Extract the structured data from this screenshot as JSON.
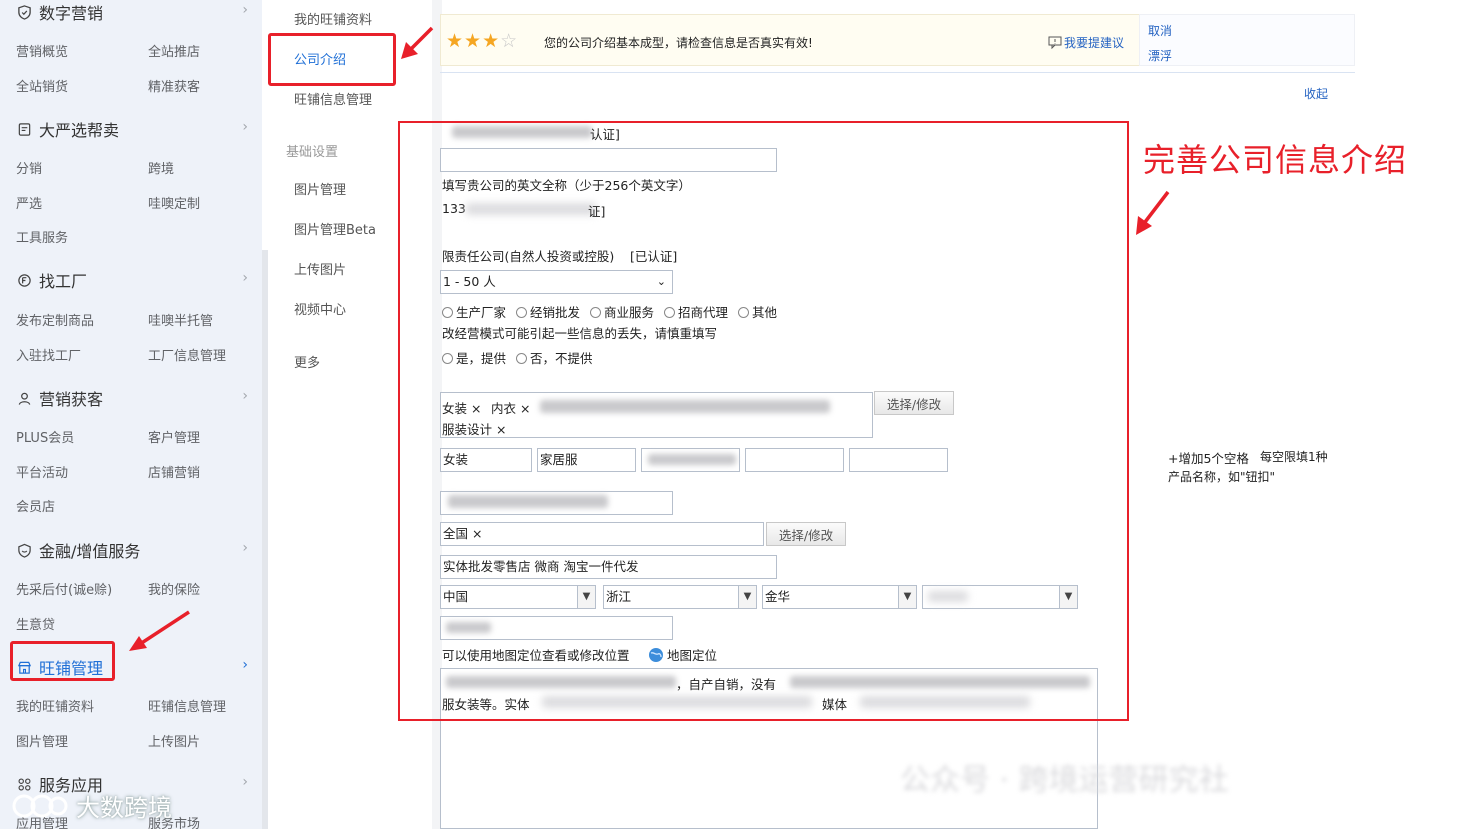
{
  "sidebar": {
    "sections": [
      {
        "title": "数字营销",
        "icon": "shield-icon",
        "links": [
          "营销概览",
          "全站推店",
          "全站销货",
          "精准获客"
        ]
      },
      {
        "title": "大严选帮卖",
        "icon": "document-icon",
        "links": [
          "分销",
          "跨境",
          "严选",
          "哇噢定制",
          "工具服务"
        ]
      },
      {
        "title": "找工厂",
        "icon": "factory-icon",
        "links": [
          "发布定制商品",
          "哇噢半托管",
          "入驻找工厂",
          "工厂信息管理"
        ]
      },
      {
        "title": "营销获客",
        "icon": "user-icon",
        "links": [
          "PLUS会员",
          "客户管理",
          "平台活动",
          "店铺营销",
          "会员店"
        ]
      },
      {
        "title": "金融/增值服务",
        "icon": "finance-icon",
        "links": [
          "先采后付(诚e赊)",
          "我的保险",
          "生意贷"
        ]
      },
      {
        "title": "旺铺管理",
        "icon": "store-icon",
        "links": [
          "我的旺铺资料",
          "旺铺信息管理",
          "图片管理",
          "上传图片"
        ]
      },
      {
        "title": "服务应用",
        "icon": "apps-icon",
        "links": [
          "应用管理",
          "服务市场"
        ]
      }
    ]
  },
  "submenu": {
    "items": [
      "我的旺铺资料",
      "公司介绍",
      "旺铺信息管理"
    ],
    "group_title": "基础设置",
    "group_items": [
      "图片管理",
      "图片管理Beta",
      "上传图片",
      "视频中心"
    ],
    "more": "更多"
  },
  "notice": {
    "stars_filled": 3,
    "stars_total": 4,
    "message": "您的公司介绍基本成型，请检查信息是否真实有效!",
    "suggest": "我要提建议",
    "cancel": "取消",
    "float": "漂浮",
    "collapse": "收起"
  },
  "form": {
    "row1_suffix": "认证]",
    "en_name_hint": "填写贵公司的英文全称（少于256个英文字）",
    "reg_prefix": "133",
    "reg_suffix": "证]",
    "company_type": "限责任公司(自然人投资或控股)",
    "company_type_tag": "[已认证]",
    "staff_select": "1 - 50 人",
    "biz_models": [
      "生产厂家",
      "经销批发",
      "商业服务",
      "招商代理",
      "其他"
    ],
    "biz_hint": "改经营模式可能引起一些信息的丢失，请慎重填写",
    "oem_options": [
      "是，提供",
      "否，不提供"
    ],
    "categories": [
      "女装 ×",
      "内衣 ×",
      "服装设计 ×"
    ],
    "choose_btn": "选择/修改",
    "products": [
      "女装",
      "家居服"
    ],
    "add5": "+增加5个空格",
    "add5_hint1": "每空限填1种",
    "add5_hint2": "产品名称，如\"钮扣\"",
    "region_tag": "全国 ×",
    "channels": "实体批发零售店 微商 淘宝一件代发",
    "country": "中国",
    "province": "浙江",
    "city": "金华",
    "map_hint": "可以使用地图定位查看或修改位置",
    "map_link": "地图定位",
    "intro_line1": "，自产自销，没有",
    "intro_line2": "服女装等。实体",
    "intro_line2b": "媒体"
  },
  "annotation": {
    "callout": "完善公司信息介绍"
  },
  "watermark": {
    "left": "大数跨境",
    "right": "公众号 · 跨境运营研究社"
  },
  "colors": {
    "annotation_red": "#e8202a",
    "link_blue": "#2563c2",
    "sidebar_bg": "#eef2f9",
    "star_gold": "#f5a623"
  }
}
